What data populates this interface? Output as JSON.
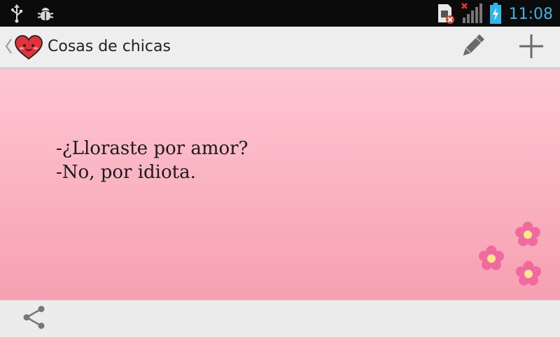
{
  "status_bar": {
    "time": "11:08",
    "icons": [
      "usb-icon",
      "debug-bug-icon",
      "sim-error-icon",
      "signal-icon",
      "battery-charging-icon"
    ]
  },
  "action_bar": {
    "title": "Cosas de chicas",
    "icons": [
      "up-caret-icon",
      "heart-app-icon",
      "pencil-icon",
      "plus-icon"
    ]
  },
  "content": {
    "lines": [
      "-¿Lloraste por amor?",
      "-No, por idiota."
    ],
    "background_top": "#ffc6d1",
    "background_bottom": "#f6a0b2",
    "decoration": "pink-flowers"
  },
  "bottom_bar": {
    "icons": [
      "share-icon"
    ]
  },
  "colors": {
    "accent_clock": "#33b5e5",
    "flower": "#f06aa0",
    "flower_center": "#ffe68a"
  }
}
